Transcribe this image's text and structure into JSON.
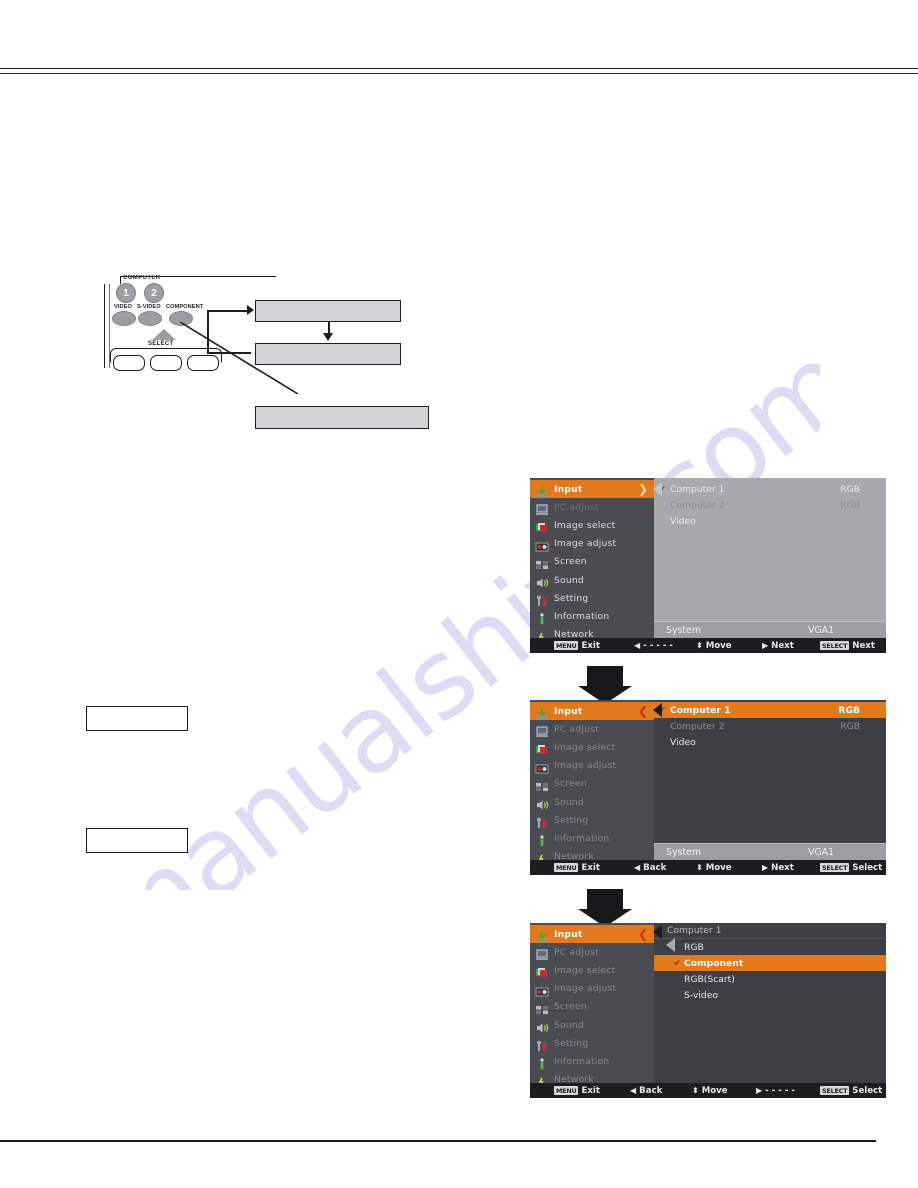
{
  "page": {
    "watermark": "manualshive.com"
  },
  "remote": {
    "cut_label": "COMPUTER",
    "buttons": [
      {
        "name": "1"
      },
      {
        "name": "2"
      }
    ],
    "source_labels": [
      "VIDEO",
      "S-VIDEO",
      "COMPONENT"
    ],
    "select_label": "SELECT"
  },
  "callouts": {
    "gray_box_1": "",
    "gray_box_2": "",
    "gray_box_3": "",
    "white_box_1": "",
    "white_box_2": ""
  },
  "osd": {
    "menu_items": [
      {
        "label": "Input",
        "icon": "input-icon"
      },
      {
        "label": "PC adjust",
        "icon": "pc-adjust-icon"
      },
      {
        "label": "Image select",
        "icon": "image-select-icon"
      },
      {
        "label": "Image adjust",
        "icon": "image-adjust-icon"
      },
      {
        "label": "Screen",
        "icon": "screen-icon"
      },
      {
        "label": "Sound",
        "icon": "sound-icon"
      },
      {
        "label": "Setting",
        "icon": "setting-icon"
      },
      {
        "label": "Information",
        "icon": "information-icon"
      },
      {
        "label": "Network",
        "icon": "network-icon"
      }
    ],
    "panel1": {
      "rows": [
        {
          "label": "Computer 1",
          "value": "RGB",
          "checked": true
        },
        {
          "label": "Computer 2",
          "value": "RGB",
          "checked": false
        },
        {
          "label": "Video",
          "value": "",
          "checked": false
        }
      ],
      "system_label": "System",
      "system_value": "VGA1",
      "footer": [
        {
          "key": "MENU",
          "action": "Exit"
        },
        {
          "glyph": "◀",
          "action": "- - - - -"
        },
        {
          "glyph": "⬍",
          "action": "Move"
        },
        {
          "glyph": "▶",
          "action": "Next"
        },
        {
          "key": "SELECT",
          "action": "Next"
        }
      ]
    },
    "panel2": {
      "rows": [
        {
          "label": "Computer 1",
          "value": "RGB",
          "checked": true
        },
        {
          "label": "Computer 2",
          "value": "RGB",
          "checked": false
        },
        {
          "label": "Video",
          "value": "",
          "checked": false
        }
      ],
      "system_label": "System",
      "system_value": "VGA1",
      "footer": [
        {
          "key": "MENU",
          "action": "Exit"
        },
        {
          "glyph": "◀",
          "action": "Back"
        },
        {
          "glyph": "⬍",
          "action": "Move"
        },
        {
          "glyph": "▶",
          "action": "Next"
        },
        {
          "key": "SELECT",
          "action": "Select"
        }
      ]
    },
    "panel3": {
      "title": "Computer 1",
      "options": [
        {
          "label": "RGB",
          "checked": false
        },
        {
          "label": "Component",
          "checked": true
        },
        {
          "label": "RGB(Scart)",
          "checked": false
        },
        {
          "label": "S-video",
          "checked": false
        }
      ],
      "footer": [
        {
          "key": "MENU",
          "action": "Exit"
        },
        {
          "glyph": "◀",
          "action": "Back"
        },
        {
          "glyph": "⬍",
          "action": "Move"
        },
        {
          "glyph": "▶",
          "action": "- - - - -"
        },
        {
          "key": "SELECT",
          "action": "Select"
        }
      ]
    }
  },
  "colors": {
    "accent": "#e2791a",
    "sidebar": "#4a4c51",
    "panel_light": "#a8a9ac",
    "panel_dark": "#3d3f44",
    "footer": "#1b1d21",
    "watermark": "#c9c8ee"
  }
}
